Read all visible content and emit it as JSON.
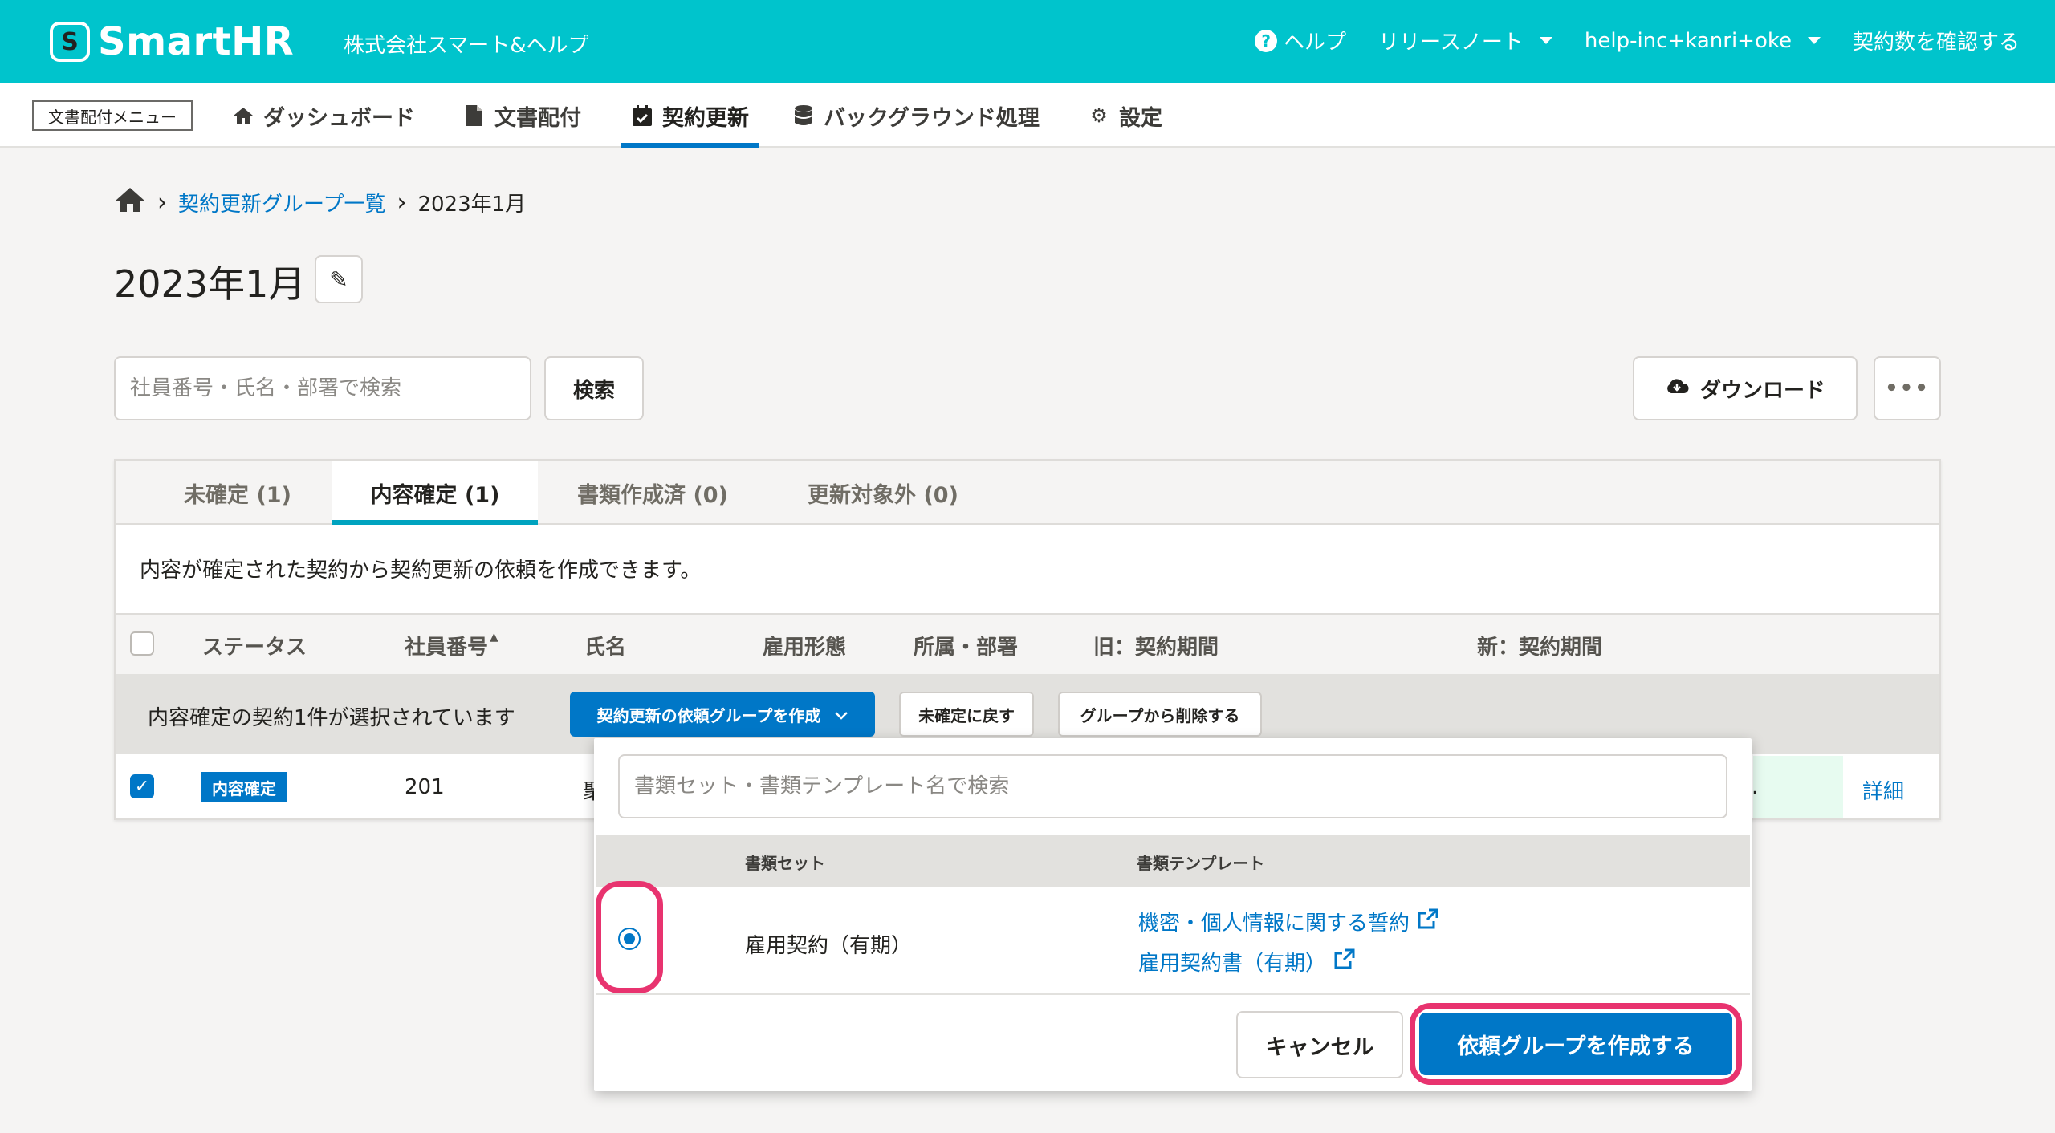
{
  "header": {
    "logo_text": "SmartHR",
    "logo_mark": "S",
    "company": "株式会社スマート&ヘルプ",
    "help": "ヘルプ",
    "release_notes": "リリースノート",
    "user": "help-inc+kanri+oke",
    "contracts": "契約数を確認する"
  },
  "subnav": {
    "label": "文書配付メニュー",
    "tabs": [
      {
        "label": "ダッシュボード",
        "icon": "home-icon"
      },
      {
        "label": "文書配付",
        "icon": "document-icon"
      },
      {
        "label": "契約更新",
        "icon": "calendar-check-icon"
      },
      {
        "label": "バックグラウンド処理",
        "icon": "database-icon"
      },
      {
        "label": "設定",
        "icon": "gear-icon"
      }
    ]
  },
  "breadcrumb": {
    "parent": "契約更新グループ一覧",
    "current": "2023年1月"
  },
  "page_title": "2023年1月",
  "search": {
    "placeholder": "社員番号・氏名・部署で検索",
    "button": "検索"
  },
  "download_label": "ダウンロード",
  "more_label": "•••",
  "tabs": [
    {
      "label": "未確定 (1)"
    },
    {
      "label": "内容確定 (1)"
    },
    {
      "label": "書類作成済 (0)"
    },
    {
      "label": "更新対象外 (0)"
    }
  ],
  "description": "内容が確定された契約から契約更新の依頼を作成できます。",
  "table": {
    "columns": [
      "ステータス",
      "社員番号",
      "氏名",
      "雇用形態",
      "所属・部署",
      "旧：契約期間",
      "新：契約期間"
    ],
    "sort_indicator": "▲",
    "bulk_text": "内容確定の契約1件が選択されています",
    "bulk_create": "契約更新の依頼グループを作成",
    "bulk_revert": "未確定に戻す",
    "bulk_remove": "グループから削除する",
    "row": {
      "status": "内容確定",
      "employee_no": "201",
      "name_fragment": "聚",
      "cell_fragment": ".",
      "detail": "詳細"
    }
  },
  "panel": {
    "search_placeholder": "書類セット・書類テンプレート名で検索",
    "col_set": "書類セット",
    "col_template": "書類テンプレート",
    "set_name": "雇用契約（有期）",
    "templates": [
      "機密・個人情報に関する誓約",
      "雇用契約書（有期）"
    ],
    "cancel": "キャンセル",
    "submit": "依頼グループを作成する"
  },
  "colors": {
    "brand": "#00c4cc",
    "accent": "#0077c7",
    "highlight": "#e8336f"
  }
}
